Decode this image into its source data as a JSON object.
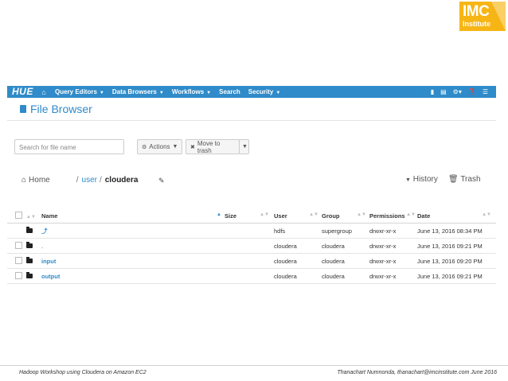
{
  "logo": {
    "line1": "IMC",
    "line2": "Institute"
  },
  "navbar": {
    "brand": "HUE",
    "home_icon": "home-icon",
    "menu": [
      {
        "label": "Query Editors"
      },
      {
        "label": "Data Browsers"
      },
      {
        "label": "Workflows"
      },
      {
        "label": "Search"
      },
      {
        "label": "Security"
      }
    ],
    "right_icons": [
      "document-icon",
      "table-icon",
      "gear-icon",
      "help-icon",
      "menu-icon"
    ]
  },
  "page": {
    "title": "File Browser"
  },
  "toolbar": {
    "search_placeholder": "Search for file name",
    "actions_label": "Actions",
    "move_trash_label": "Move to trash"
  },
  "breadcrumb": {
    "home": "Home",
    "sep1": "/",
    "user": "user",
    "sep2": "/",
    "current": "cloudera",
    "history": "History",
    "trash": "Trash"
  },
  "table": {
    "headers": [
      "Name",
      "Size",
      "User",
      "Group",
      "Permissions",
      "Date"
    ],
    "rows": [
      {
        "name": "⤴",
        "size": "",
        "user": "hdfs",
        "group": "supergroup",
        "perm": "drwxr-xr-x",
        "date": "June 13, 2016 08:34 PM",
        "checkbox": false
      },
      {
        "name": ".",
        "size": "",
        "user": "cloudera",
        "group": "cloudera",
        "perm": "drwxr-xr-x",
        "date": "June 13, 2016 09:21 PM",
        "checkbox": true
      },
      {
        "name": "input",
        "size": "",
        "user": "cloudera",
        "group": "cloudera",
        "perm": "drwxr-xr-x",
        "date": "June 13, 2016 09:20 PM",
        "checkbox": true
      },
      {
        "name": "output",
        "size": "",
        "user": "cloudera",
        "group": "cloudera",
        "perm": "drwxr-xr-x",
        "date": "June 13, 2016 09:21 PM",
        "checkbox": true
      }
    ]
  },
  "footer": {
    "left": "Hadoop Workshop using Cloudera on Amazon EC2",
    "right": "Thanachart Numnonda,  thanachart@imcinstitute.com  June 2016"
  },
  "colors": {
    "accent": "#2f8bc9",
    "logo": "#f7b515"
  }
}
